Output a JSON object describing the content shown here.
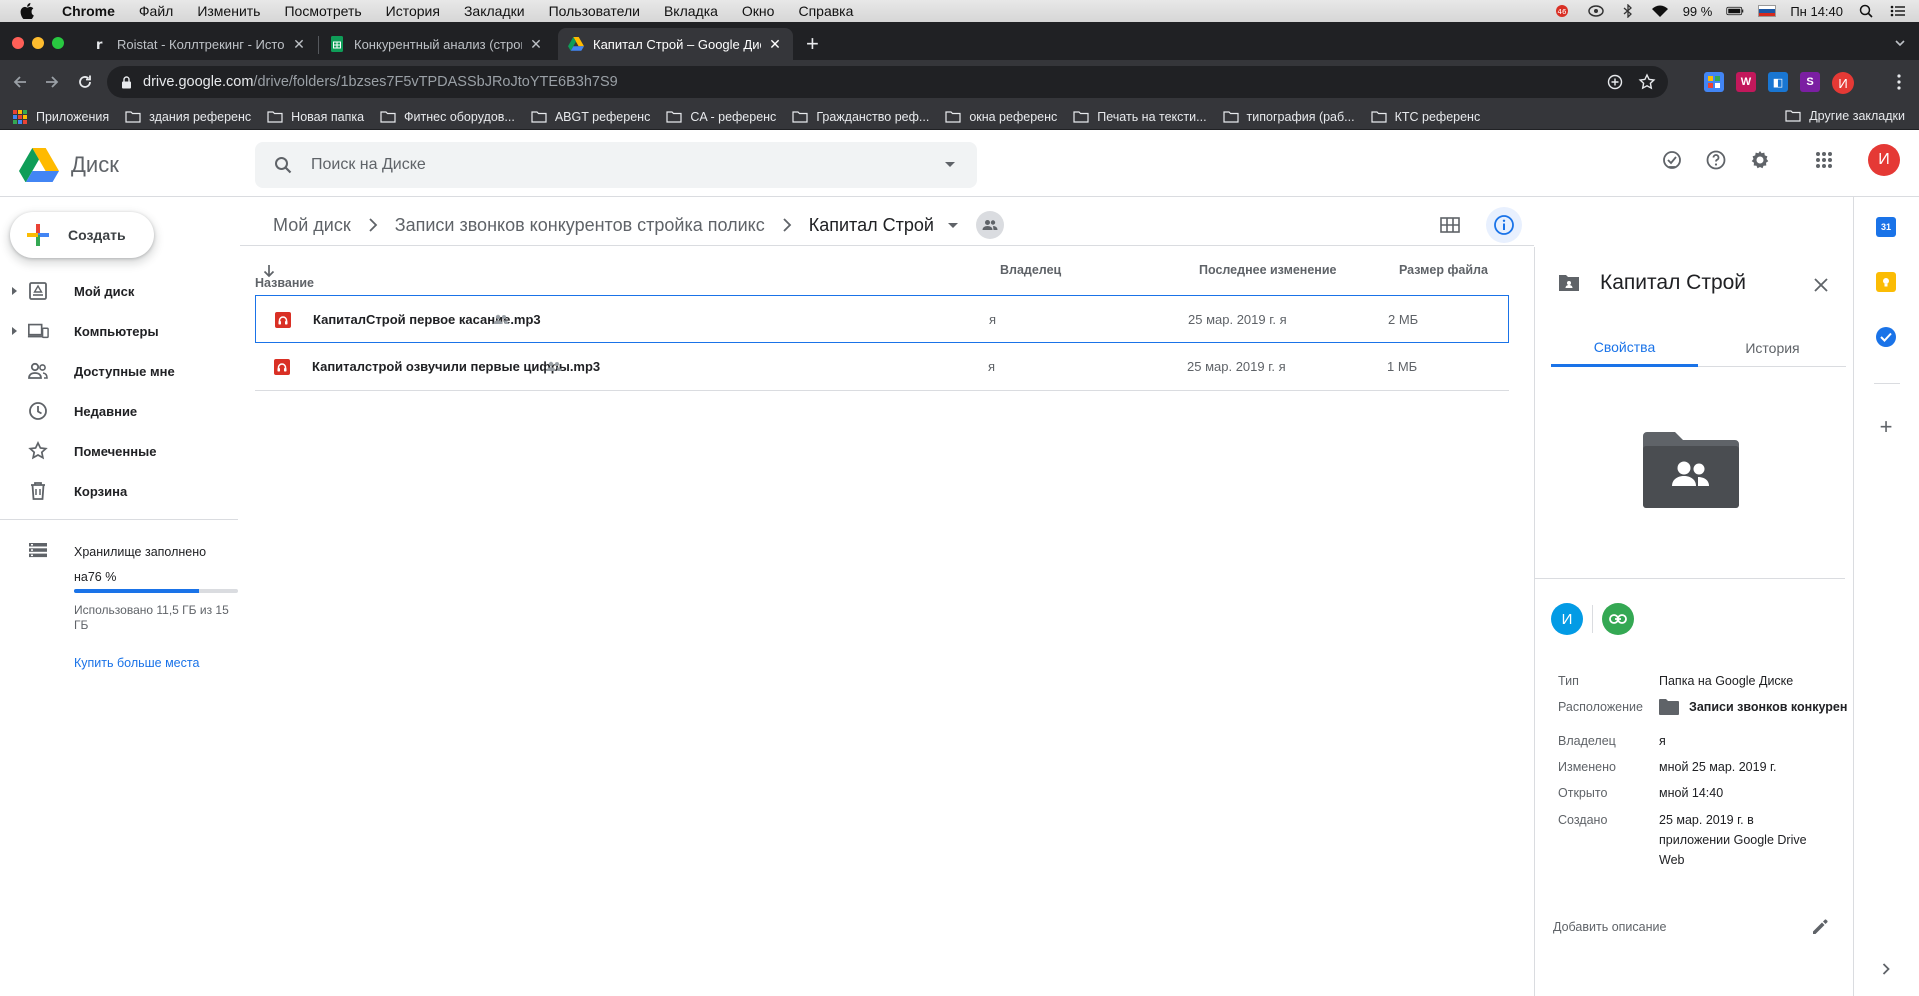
{
  "mac_menubar": {
    "app_name": "Chrome",
    "menus": [
      "Файл",
      "Изменить",
      "Посмотреть",
      "История",
      "Закладки",
      "Пользователи",
      "Вкладка",
      "Окно",
      "Справка"
    ],
    "battery": "99 %",
    "clock": "Пн 14:40",
    "notification_badge": "46"
  },
  "browser": {
    "tabs": [
      {
        "title": "Roistat - Коллтрекинг - Истор",
        "favicon": "roistat-icon",
        "active": false
      },
      {
        "title": "Конкурентный анализ (строи",
        "favicon": "sheets-icon",
        "active": false
      },
      {
        "title": "Капитал Строй – Google Диск",
        "favicon": "drive-icon",
        "active": true
      }
    ],
    "url_domain": "drive.google.com",
    "url_path": "/drive/folders/1bzses7F5vTPDASSbJRoJtoYTE6B3h7S9",
    "profile_initial": "И",
    "extensions": [
      {
        "label": "",
        "color": "#4285f4"
      },
      {
        "label": "W",
        "color": "#c2185b"
      },
      {
        "label": "◧",
        "color": "#1976d2"
      },
      {
        "label": "S",
        "color": "#7b1fa2"
      }
    ],
    "bookmarks": [
      "Приложения",
      "здания референс",
      "Новая папка",
      "Фитнес оборудов...",
      "ABGT референс",
      "CA - референс",
      "Гражданство реф...",
      "окна референс",
      "Печать на тексти...",
      "типография (раб...",
      "КТС референс"
    ],
    "other_bookmarks": "Другие закладки"
  },
  "drive": {
    "logo_text": "Диск",
    "search_placeholder": "Поиск на Диске",
    "avatar_initial": "И",
    "create_label": "Создать",
    "nav": [
      {
        "label": "Мой диск",
        "icon": "my-drive-icon",
        "expandable": true
      },
      {
        "label": "Компьютеры",
        "icon": "computers-icon",
        "expandable": true
      },
      {
        "label": "Доступные мне",
        "icon": "shared-with-me-icon",
        "expandable": false
      },
      {
        "label": "Недавние",
        "icon": "clock-icon",
        "expandable": false
      },
      {
        "label": "Помеченные",
        "icon": "star-icon",
        "expandable": false
      },
      {
        "label": "Корзина",
        "icon": "trash-icon",
        "expandable": false
      }
    ],
    "storage": {
      "title": "Хранилище заполнено на76 %",
      "used_fraction": 0.76,
      "used_text": "Использовано 11,5 ГБ из 15 ГБ",
      "buy_label": "Купить больше места"
    },
    "breadcrumb": [
      "Мой диск",
      "Записи звонков конкурентов стройка поликс",
      "Капитал Строй"
    ],
    "columns": {
      "name": "Название",
      "owner": "Владелец",
      "modified": "Последнее изменение",
      "size": "Размер файла"
    },
    "files": [
      {
        "name": "КапиталСтрой первое касание.mp3",
        "owner": "я",
        "modified": "25 мар. 2019 г. я",
        "size": "2 МБ",
        "selected": true
      },
      {
        "name": "Капиталстрой озвучили первые цифры.mp3",
        "owner": "я",
        "modified": "25 мар. 2019 г. я",
        "size": "1 МБ",
        "selected": false
      }
    ],
    "details": {
      "title": "Капитал Строй",
      "tab_properties": "Свойства",
      "tab_history": "История",
      "owner_initial": "И",
      "props": [
        {
          "label": "Тип",
          "value": "Папка на Google Диске"
        },
        {
          "label": "Расположение",
          "value": "Записи звонков конкурен"
        },
        {
          "label": "Владелец",
          "value": "я"
        },
        {
          "label": "Изменено",
          "value": "мной 25 мар. 2019 г."
        },
        {
          "label": "Открыто",
          "value": "мной 14:40"
        },
        {
          "label": "Создано",
          "value": "25 мар. 2019 г. в приложении Google Drive Web"
        }
      ],
      "add_description": "Добавить описание"
    },
    "side_panel_calendar_day": "31"
  }
}
